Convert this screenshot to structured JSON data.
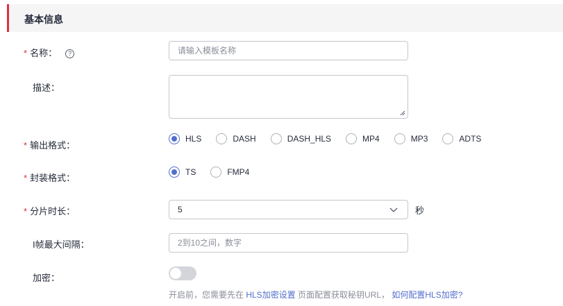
{
  "section": {
    "title": "基本信息"
  },
  "fields": {
    "name": {
      "label": "名称：",
      "required": "*",
      "help_icon": "?",
      "placeholder": "请输入模板名称",
      "value": ""
    },
    "description": {
      "label": "描述：",
      "value": ""
    },
    "output_format": {
      "label": "输出格式：",
      "required": "*",
      "options": [
        "HLS",
        "DASH",
        "DASH_HLS",
        "MP4",
        "MP3",
        "ADTS"
      ],
      "selected": "HLS"
    },
    "package_format": {
      "label": "封装格式：",
      "required": "*",
      "options": [
        "TS",
        "FMP4"
      ],
      "selected": "TS"
    },
    "segment_duration": {
      "label": "分片时长：",
      "required": "*",
      "value": "5",
      "unit": "秒",
      "icon": "chevron-down-icon"
    },
    "i_frame_interval": {
      "label": "I帧最大间隔：",
      "placeholder": "2到10之间，数字",
      "value": ""
    },
    "encryption": {
      "label": "加密：",
      "enabled": false,
      "hint_prefix": "开启前，您需要先在 ",
      "hint_link1": "HLS加密设置",
      "hint_middle": " 页面配置获取秘钥URL， ",
      "hint_link2": "如何配置HLS加密?"
    }
  },
  "colors": {
    "accent": "#526ecc",
    "required": "#e02e3c",
    "header_bg": "#f5f5f6",
    "toggle_off": "#d3d5da"
  }
}
